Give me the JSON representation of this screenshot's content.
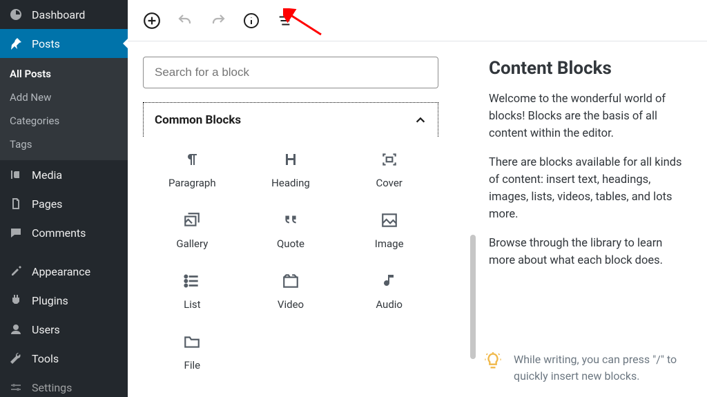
{
  "sidebar": {
    "items": [
      {
        "label": "Dashboard",
        "icon": "dashboard-icon",
        "current": false
      },
      {
        "label": "Posts",
        "icon": "pin-icon",
        "current": true,
        "subitems": [
          {
            "label": "All Posts",
            "current": true
          },
          {
            "label": "Add New",
            "current": false
          },
          {
            "label": "Categories",
            "current": false
          },
          {
            "label": "Tags",
            "current": false
          }
        ]
      },
      {
        "label": "Media",
        "icon": "media-icon",
        "current": false
      },
      {
        "label": "Pages",
        "icon": "pages-icon",
        "current": false
      },
      {
        "label": "Comments",
        "icon": "comments-icon",
        "current": false
      },
      {
        "label": "Appearance",
        "icon": "appearance-icon",
        "current": false
      },
      {
        "label": "Plugins",
        "icon": "plugins-icon",
        "current": false
      },
      {
        "label": "Users",
        "icon": "users-icon",
        "current": false
      },
      {
        "label": "Tools",
        "icon": "tools-icon",
        "current": false
      },
      {
        "label": "Settings",
        "icon": "settings-icon",
        "current": false
      }
    ]
  },
  "toolbar": {
    "add": "Add block",
    "undo": "Undo",
    "redo": "Redo",
    "info": "Content structure",
    "outline": "Block navigation"
  },
  "inserter": {
    "search_placeholder": "Search for a block",
    "section_label": "Common Blocks",
    "blocks": [
      {
        "label": "Paragraph",
        "icon": "paragraph-icon"
      },
      {
        "label": "Heading",
        "icon": "heading-icon"
      },
      {
        "label": "Cover",
        "icon": "cover-icon"
      },
      {
        "label": "Gallery",
        "icon": "gallery-icon"
      },
      {
        "label": "Quote",
        "icon": "quote-icon"
      },
      {
        "label": "Image",
        "icon": "image-icon"
      },
      {
        "label": "List",
        "icon": "list-icon"
      },
      {
        "label": "Video",
        "icon": "video-icon"
      },
      {
        "label": "Audio",
        "icon": "audio-icon"
      },
      {
        "label": "File",
        "icon": "file-icon"
      }
    ]
  },
  "right": {
    "title": "Content Blocks",
    "p1": "Welcome to the wonderful world of blocks! Blocks are the basis of all content within the editor.",
    "p2": "There are blocks available for all kinds of content: insert text, headings, images, lists, videos, tables, and lots more.",
    "p3": "Browse through the library to learn more about what each block does.",
    "tip": "While writing, you can press \"/\" to quickly insert new blocks."
  },
  "colors": {
    "accent": "#0073aa",
    "sidebar_bg": "#23282d",
    "sidebar_sub_bg": "#32373c",
    "text_muted": "#6c7781",
    "tip_icon": "#f0b849",
    "annotation_arrow": "#ff0000"
  }
}
